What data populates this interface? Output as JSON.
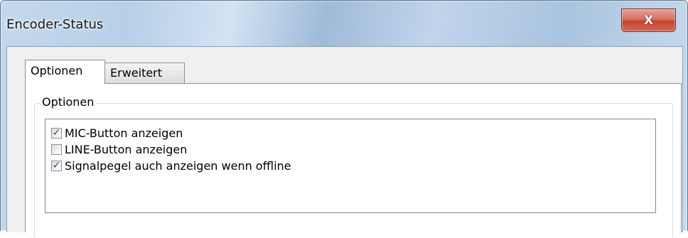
{
  "window": {
    "title": "Encoder-Status",
    "close_label": "X"
  },
  "tabs": [
    {
      "label": "Optionen",
      "active": true
    },
    {
      "label": "Erweitert",
      "active": false
    }
  ],
  "group": {
    "legend": "Optionen",
    "items": [
      {
        "label": "MIC-Button anzeigen",
        "checked": true,
        "mark": "✓"
      },
      {
        "label": "LINE-Button anzeigen",
        "checked": false,
        "mark": ""
      },
      {
        "label": "Signalpegel auch anzeigen wenn offline",
        "checked": true,
        "mark": "✓"
      }
    ]
  }
}
